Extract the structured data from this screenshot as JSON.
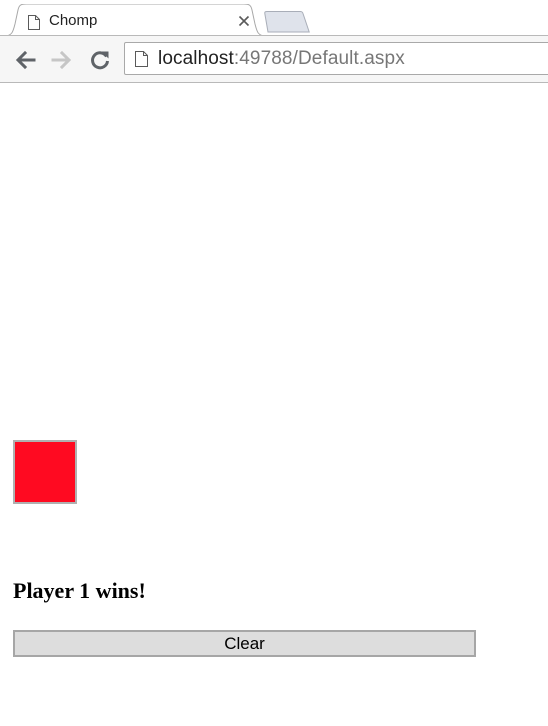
{
  "browser": {
    "tab": {
      "title": "Chomp"
    },
    "omnibox": {
      "host": "localhost",
      "rest": ":49788/Default.aspx"
    }
  },
  "page": {
    "board": {
      "cell_color": "#ff0a21"
    },
    "status": "Player 1 wins!",
    "clear_label": "Clear"
  }
}
